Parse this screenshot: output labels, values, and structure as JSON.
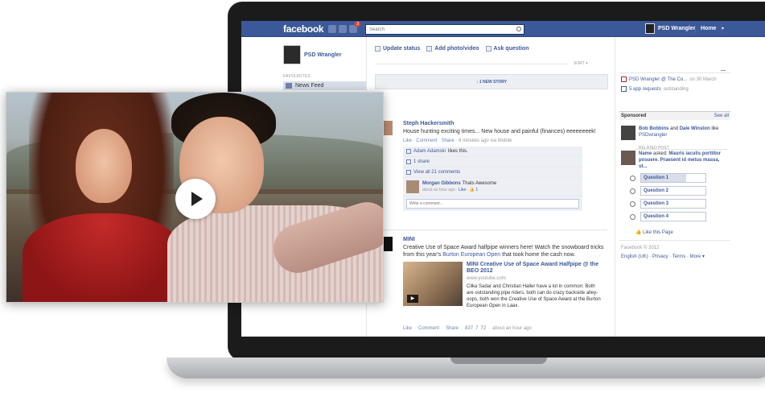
{
  "topbar": {
    "logo": "facebook",
    "notification_count": "3",
    "search_placeholder": "Search",
    "user_name": "PSD Wrangler",
    "home_label": "Home",
    "caret": "▾"
  },
  "left_nav": {
    "profile_name": "PSD Wrangler",
    "section_heading": "FAVOURITES",
    "items": [
      {
        "label": "News Feed"
      }
    ]
  },
  "composer": {
    "actions": [
      {
        "label": "Update status"
      },
      {
        "label": "Add photo/video"
      },
      {
        "label": "Ask question"
      }
    ]
  },
  "feed": {
    "sort_label": "SORT ▾",
    "new_story_label": "↓ 1 NEW STORY",
    "story1": {
      "author": "Steph Hackersmith",
      "text": "House hunting exciting times... New house and painful (finances) eeeeeeeek!",
      "like": "Like",
      "comment": "Comment",
      "share": "Share",
      "time": "8 minutes ago via Mobile",
      "likes_name": "Adam Adamski",
      "likes_suffix": "likes this.",
      "shares": "1 share",
      "view_all": "View all 21 comments",
      "comment_author": "Morgan Gibbons",
      "comment_text": "Thats Awesome",
      "comment_time": "about an hour ago",
      "comment_like": "Like",
      "comment_like_count": "1",
      "write_placeholder": "Write a comment..."
    },
    "story2": {
      "author": "MINI",
      "text_before": "Creative Use of Space Award halfpipe winners here! Watch the snowboard tricks from this year's ",
      "text_link": "Burton European Open",
      "text_after": " that took home the cash now.",
      "attach_title": "MINI Creative Use of Space Award Halfpipe @ the BEO 2012",
      "attach_url": "www.youtube.com",
      "attach_desc": "Cilka Sadar and Christian Haller have a lot in common: Both are outstanding pipe riders, both can do crazy backside alley-oops, both won the Creative Use of Space Award at the Burton European Open in Laax.",
      "like": "Like",
      "comment": "Comment",
      "share": "Share",
      "likes_count": "837",
      "comments_count": "7",
      "shares_count": "72",
      "time": "about an hour ago"
    }
  },
  "right_col": {
    "reminder1_link": "PSD Wrangler @ The Co...",
    "reminder1_date": "on 30 March",
    "reminder2_link": "5 app requests",
    "reminder2_suffix": "outstanding",
    "sponsored_title": "Sponsored",
    "see_all": "See all",
    "ad1_name1": "Bob Bobbins",
    "ad1_and": "and",
    "ad1_name2": "Dale Winston",
    "ad1_like": "like",
    "ad1_page": "PSDwrangler",
    "related_heading": "RELATED POST",
    "ad2_name": "Name",
    "ad2_asked": "asked:",
    "ad2_question": "Mauris iaculis porttitor posuere. Praesent id metus massa, ut...",
    "questions": [
      {
        "label": "Question 1",
        "fill": 0.7
      },
      {
        "label": "Question 2",
        "fill": 0.0
      },
      {
        "label": "Question 3",
        "fill": 0.0
      },
      {
        "label": "Question 4",
        "fill": 0.0
      }
    ],
    "like_page": "Like this Page",
    "footer_copy": "Facebook © 2012",
    "footer_links": "English (UK) · Privacy · Terms · More ▾"
  },
  "video": {
    "play_label": "Play video"
  }
}
